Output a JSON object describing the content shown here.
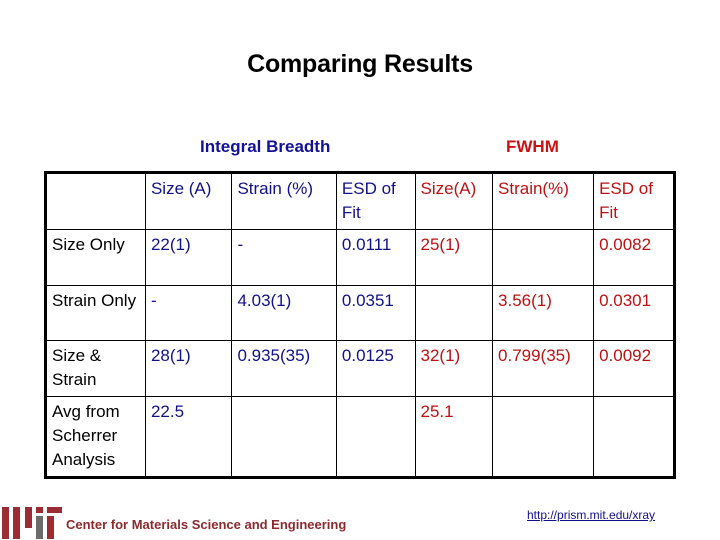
{
  "title": "Comparing Results",
  "groups": {
    "integral_breadth": "Integral Breadth",
    "fwhm": "FWHM"
  },
  "colors": {
    "integral_breadth": "#111188",
    "fwhm": "#bb1111",
    "logo_red": "#9b2c33",
    "logo_gray": "#6b6b6b"
  },
  "table": {
    "headers": [
      "",
      "Size (A)",
      "Strain (%)",
      "ESD of Fit",
      "Size(A)",
      "Strain(%)",
      "ESD of Fit"
    ],
    "rows": [
      {
        "label": "Size Only",
        "cells": [
          "22(1)",
          "-",
          "0.0111",
          "25(1)",
          "",
          "0.0082"
        ]
      },
      {
        "label": "Strain Only",
        "cells": [
          "-",
          "4.03(1)",
          "0.0351",
          "",
          "3.56(1)",
          "0.0301"
        ]
      },
      {
        "label": "Size & Strain",
        "cells": [
          "28(1)",
          "0.935(35)",
          "0.0125",
          "32(1)",
          "0.799(35)",
          "0.0092"
        ]
      },
      {
        "label": "Avg from Scherrer Analysis",
        "cells": [
          "22.5",
          "",
          "",
          "25.1",
          "",
          ""
        ]
      }
    ]
  },
  "footer": {
    "org": "Center for Materials Science and Engineering",
    "url": "http://prism.mit.edu/xray",
    "logo": "mit-logo"
  }
}
